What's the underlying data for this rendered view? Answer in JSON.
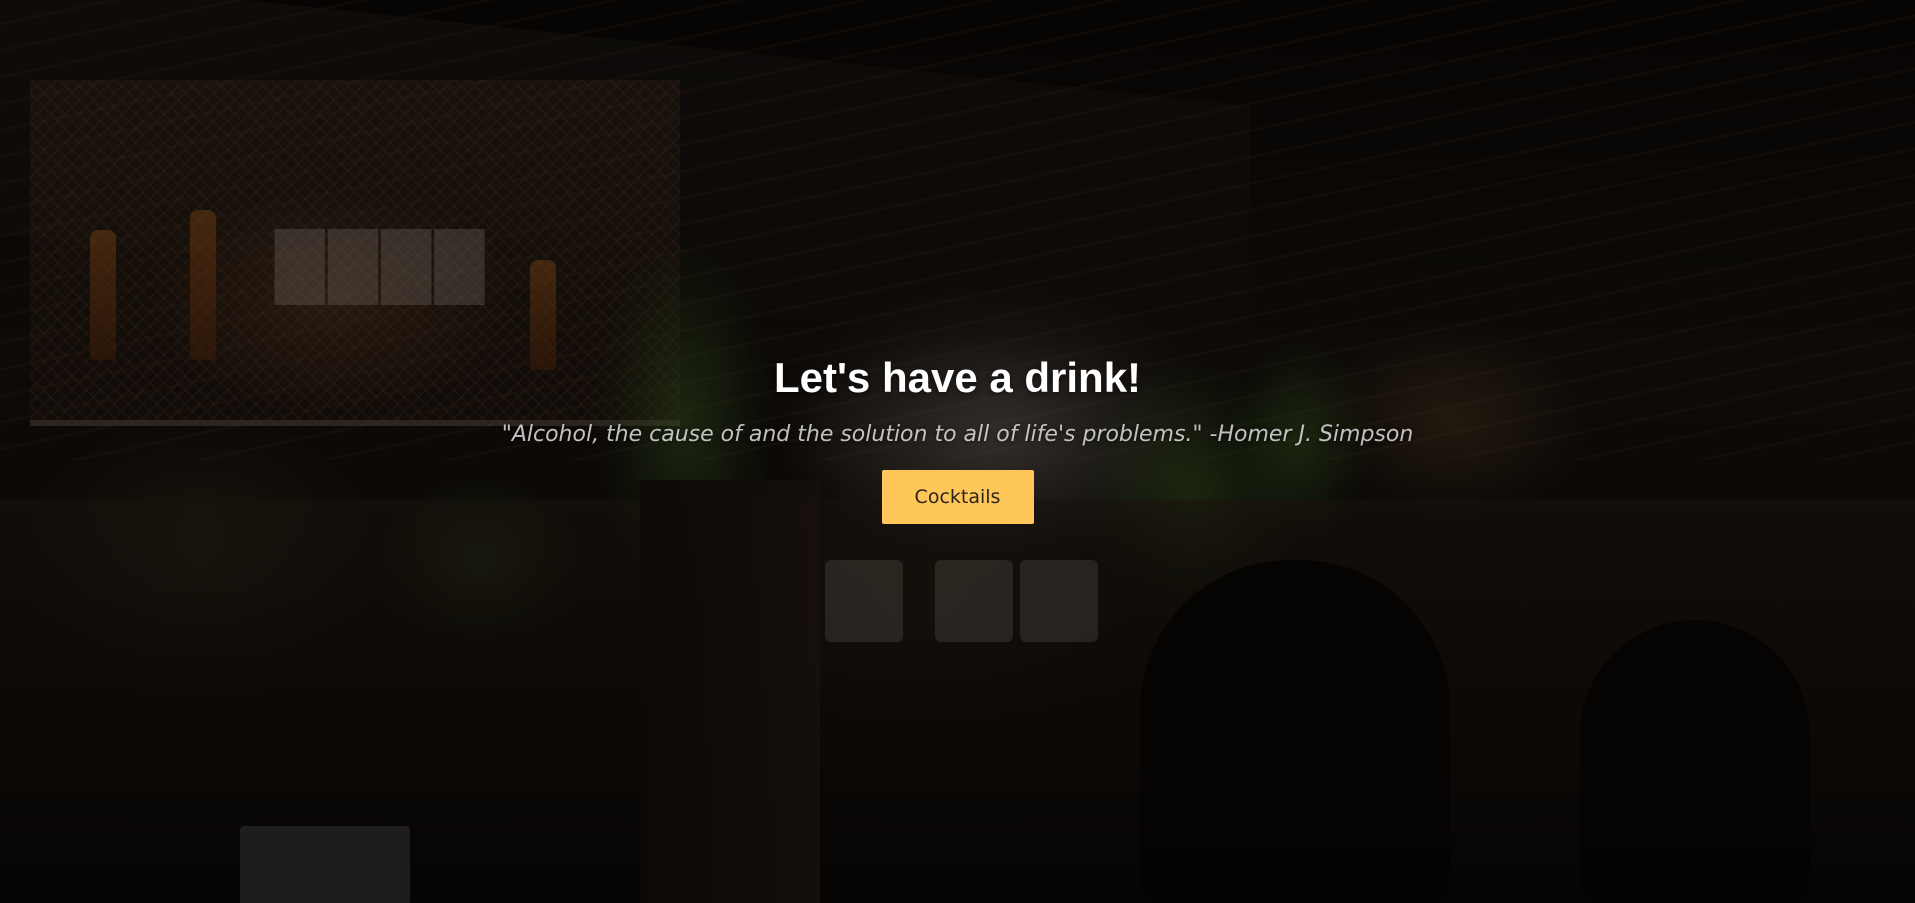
{
  "hero": {
    "title": "Let's have a drink!",
    "quote": "\"Alcohol, the cause of and the solution to all of life's problems.\" -Homer J. Simpson",
    "cta_label": "Cocktails"
  },
  "colors": {
    "cta_background": "#ffc759",
    "title": "#ffffff"
  },
  "background": {
    "description_icon": "bar-interior-photo"
  }
}
